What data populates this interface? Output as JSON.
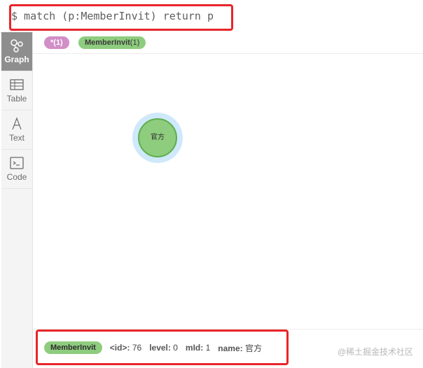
{
  "query": {
    "text": "$ match (p:MemberInvit) return p"
  },
  "nav": {
    "items": [
      {
        "label": "Graph",
        "icon": "graph-icon",
        "active": true
      },
      {
        "label": "Table",
        "icon": "table-icon",
        "active": false
      },
      {
        "label": "Text",
        "icon": "text-icon",
        "active": false
      },
      {
        "label": "Code",
        "icon": "code-icon",
        "active": false
      }
    ]
  },
  "labels": {
    "all": {
      "name": "*",
      "count": "(1)"
    },
    "member": {
      "name": "MemberInvit",
      "count": "(1)"
    }
  },
  "graph": {
    "node_caption": "官方"
  },
  "details": {
    "label": "MemberInvit",
    "properties": [
      {
        "key": "<id>:",
        "value": "76"
      },
      {
        "key": "level:",
        "value": "0"
      },
      {
        "key": "mId:",
        "value": "1"
      },
      {
        "key": "name:",
        "value": "官方"
      }
    ]
  },
  "watermark": "@稀土掘金技术社区",
  "colors": {
    "highlight": "#e8252a",
    "node_fill": "#8ecc7e",
    "all_pill": "#d18ec7",
    "halo": "#cfe9fb"
  }
}
